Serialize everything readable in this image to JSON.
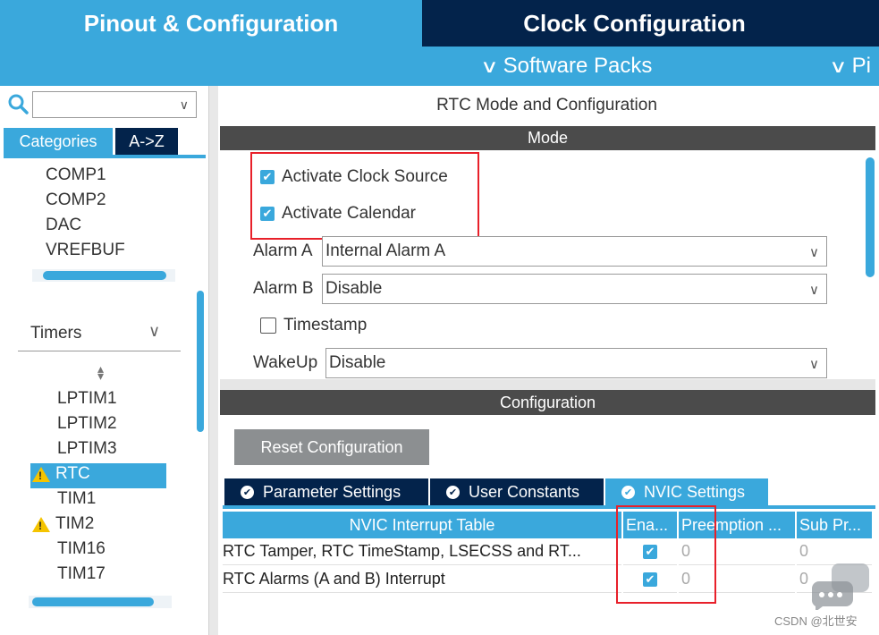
{
  "top_tabs": {
    "pinout": "Pinout & Configuration",
    "clock": "Clock Configuration"
  },
  "sub_bar": {
    "software_packs": "Software Packs",
    "pi_partial": "Pi"
  },
  "left": {
    "categories_tab": "Categories",
    "az_tab": "A->Z",
    "analog_items": [
      "COMP1",
      "COMP2",
      "DAC",
      "VREFBUF"
    ],
    "timers_header": "Timers",
    "timer_items": [
      {
        "label": "LPTIM1",
        "warn": false
      },
      {
        "label": "LPTIM2",
        "warn": false
      },
      {
        "label": "LPTIM3",
        "warn": false
      },
      {
        "label": "RTC",
        "warn": true,
        "selected": true
      },
      {
        "label": "TIM1",
        "warn": false
      },
      {
        "label": "TIM2",
        "warn": true
      },
      {
        "label": "TIM16",
        "warn": false
      },
      {
        "label": "TIM17",
        "warn": false
      }
    ]
  },
  "mode": {
    "title": "RTC Mode and Configuration",
    "header": "Mode",
    "activate_clock_source": {
      "label": "Activate Clock Source",
      "checked": true
    },
    "activate_calendar": {
      "label": "Activate Calendar",
      "checked": true
    },
    "alarm_a": {
      "label": "Alarm A",
      "value": "Internal Alarm A"
    },
    "alarm_b": {
      "label": "Alarm B",
      "value": "Disable"
    },
    "timestamp": {
      "label": "Timestamp",
      "checked": false
    },
    "wakeup": {
      "label": "WakeUp",
      "value": "Disable"
    }
  },
  "configuration": {
    "header": "Configuration",
    "reset_button": "Reset Configuration",
    "tabs": [
      "Parameter Settings",
      "User Constants",
      "NVIC Settings"
    ],
    "table": {
      "headers": [
        "NVIC Interrupt Table",
        "Ena...",
        "Preemption ...",
        "Sub Pr..."
      ],
      "rows": [
        {
          "name": "RTC Tamper, RTC TimeStamp, LSECSS and RT...",
          "enabled": true,
          "preemption": "0",
          "sub": "0"
        },
        {
          "name": "RTC Alarms (A and B) Interrupt",
          "enabled": true,
          "preemption": "0",
          "sub": "0"
        }
      ]
    }
  },
  "watermark": "CSDN @北世安",
  "colors": {
    "accent_blue": "#3aa8dc",
    "navy": "#03234b",
    "dark_bar": "#4b4b4b",
    "highlight_red": "#e8202a",
    "warning_yellow": "#f5c400"
  }
}
